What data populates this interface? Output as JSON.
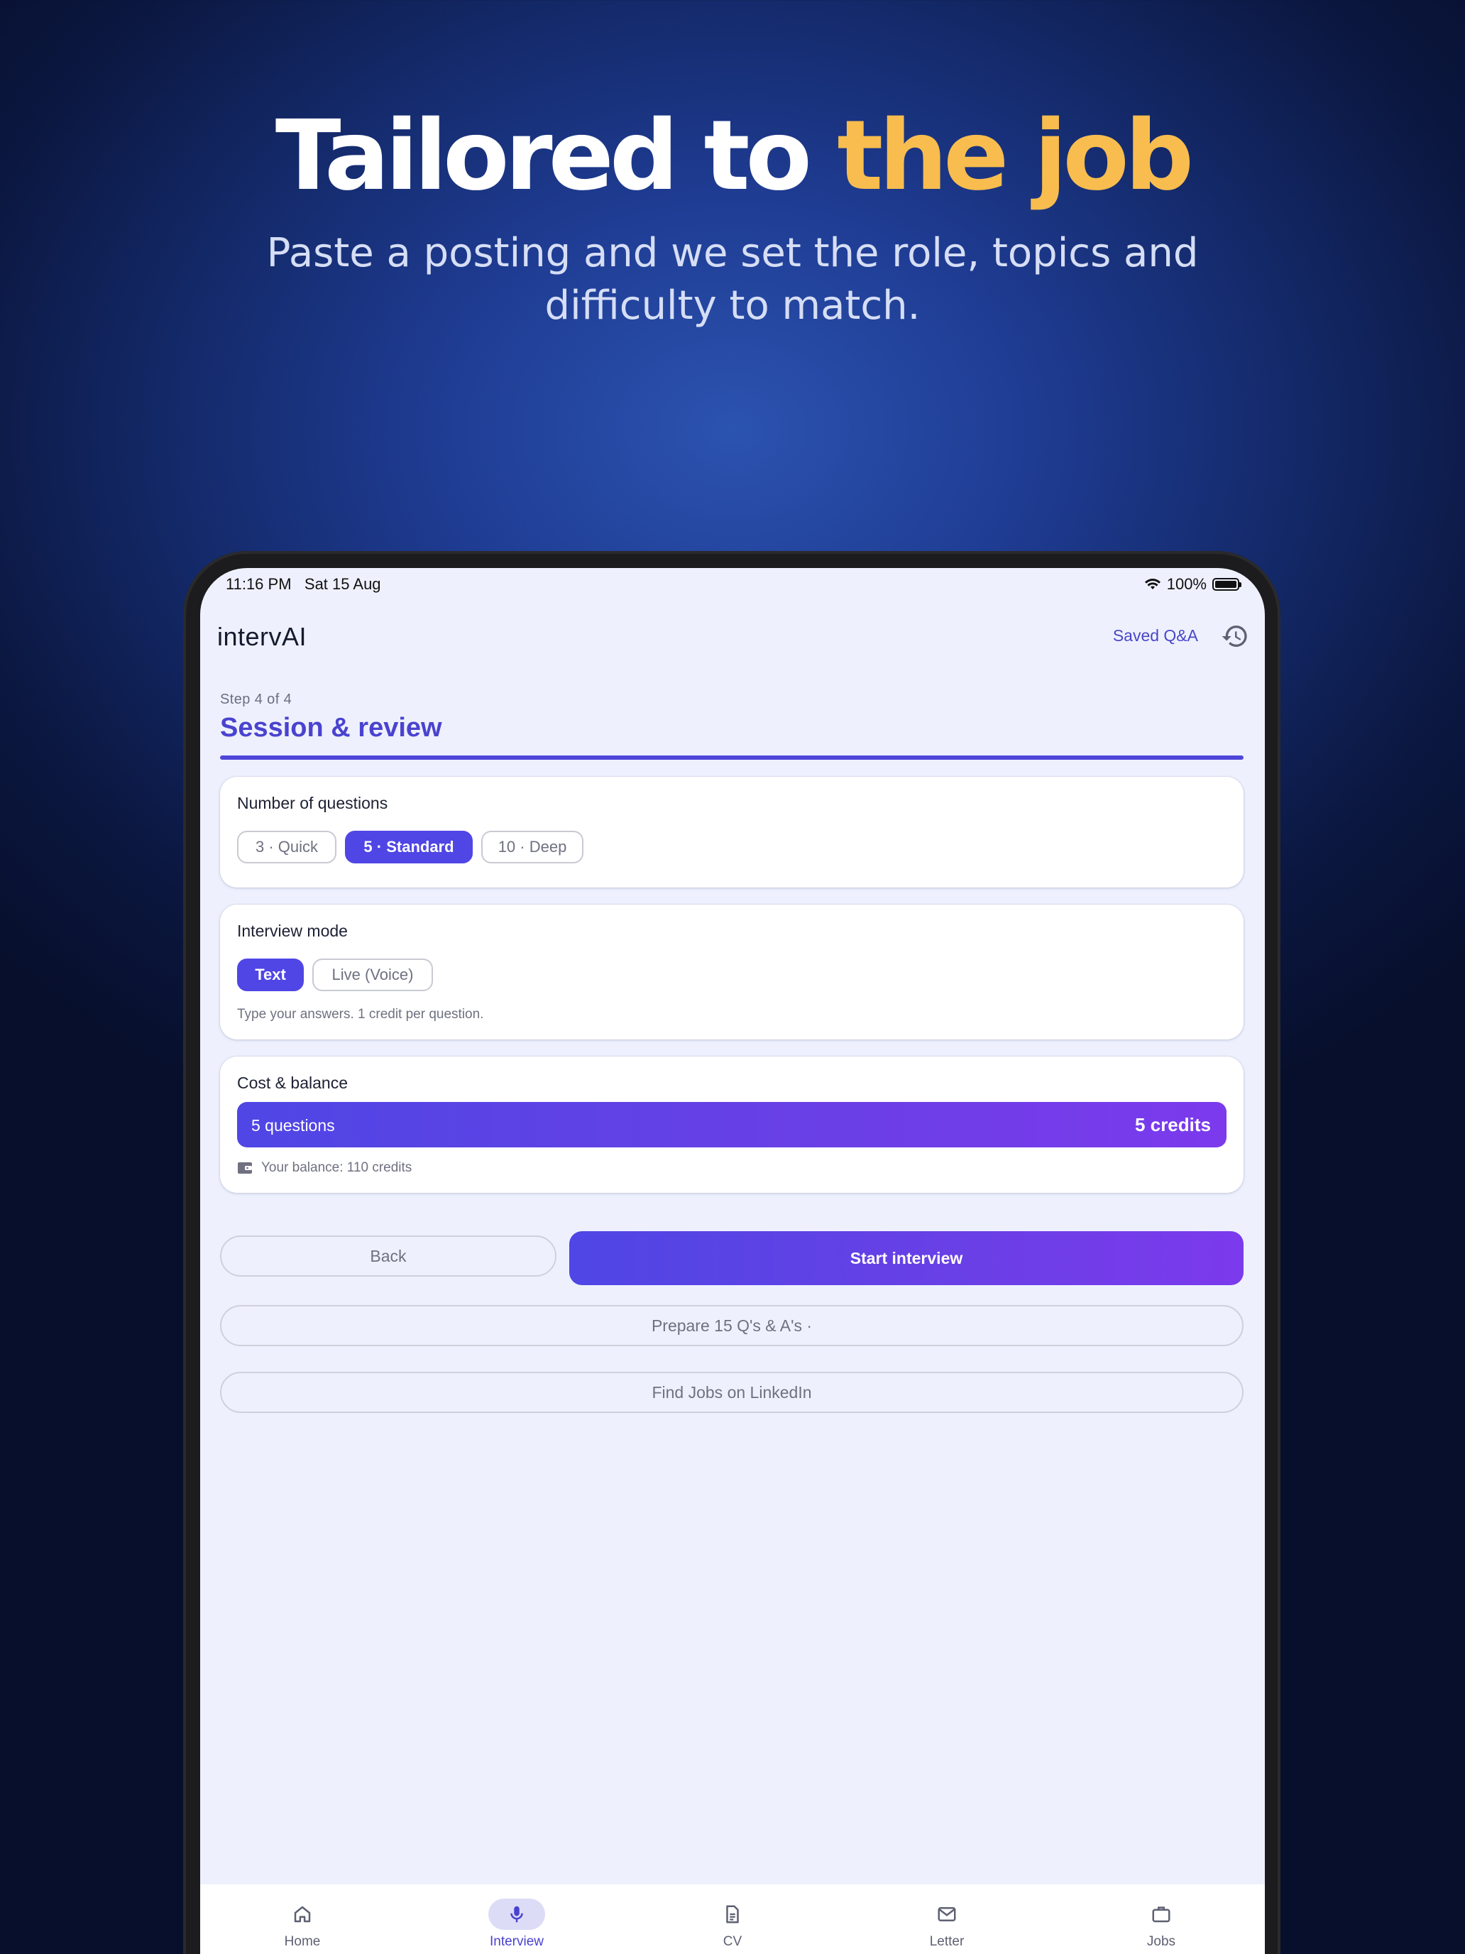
{
  "hero": {
    "title_main": "Tailored to ",
    "title_accent": "the job",
    "subtitle": "Paste a posting and we set the role, topics and difficulty to match."
  },
  "status_bar": {
    "time": "11:16 PM",
    "date": "Sat 15 Aug",
    "battery": "100%"
  },
  "app": {
    "title": "intervAI",
    "saved_link": "Saved Q&A"
  },
  "step": {
    "label": "Step 4 of 4",
    "title": "Session & review"
  },
  "questions_card": {
    "title": "Number of questions",
    "options": [
      "3 · Quick",
      "5 · Standard",
      "10 · Deep"
    ],
    "selected": "5 · Standard"
  },
  "mode_card": {
    "title": "Interview mode",
    "options": [
      "Text",
      "Live (Voice)"
    ],
    "selected": "Text",
    "helper": "Type your answers. 1 credit per question."
  },
  "cost_card": {
    "title": "Cost & balance",
    "questions": "5 questions",
    "credits": "5 credits",
    "balance": "Your balance: 110 credits"
  },
  "actions": {
    "back": "Back",
    "start": "Start interview",
    "prepare": "Prepare 15 Q's & A's ·",
    "linkedin": "Find Jobs on LinkedIn"
  },
  "tabs": [
    {
      "label": "Home",
      "icon": "home-icon"
    },
    {
      "label": "Interview",
      "icon": "microphone-icon"
    },
    {
      "label": "CV",
      "icon": "document-icon"
    },
    {
      "label": "Letter",
      "icon": "mail-icon"
    },
    {
      "label": "Jobs",
      "icon": "briefcase-icon"
    }
  ],
  "active_tab": "Interview",
  "colors": {
    "accent": "#4f46e5",
    "accent_end": "#7c3aed",
    "headline_accent": "#f8bd4e"
  }
}
